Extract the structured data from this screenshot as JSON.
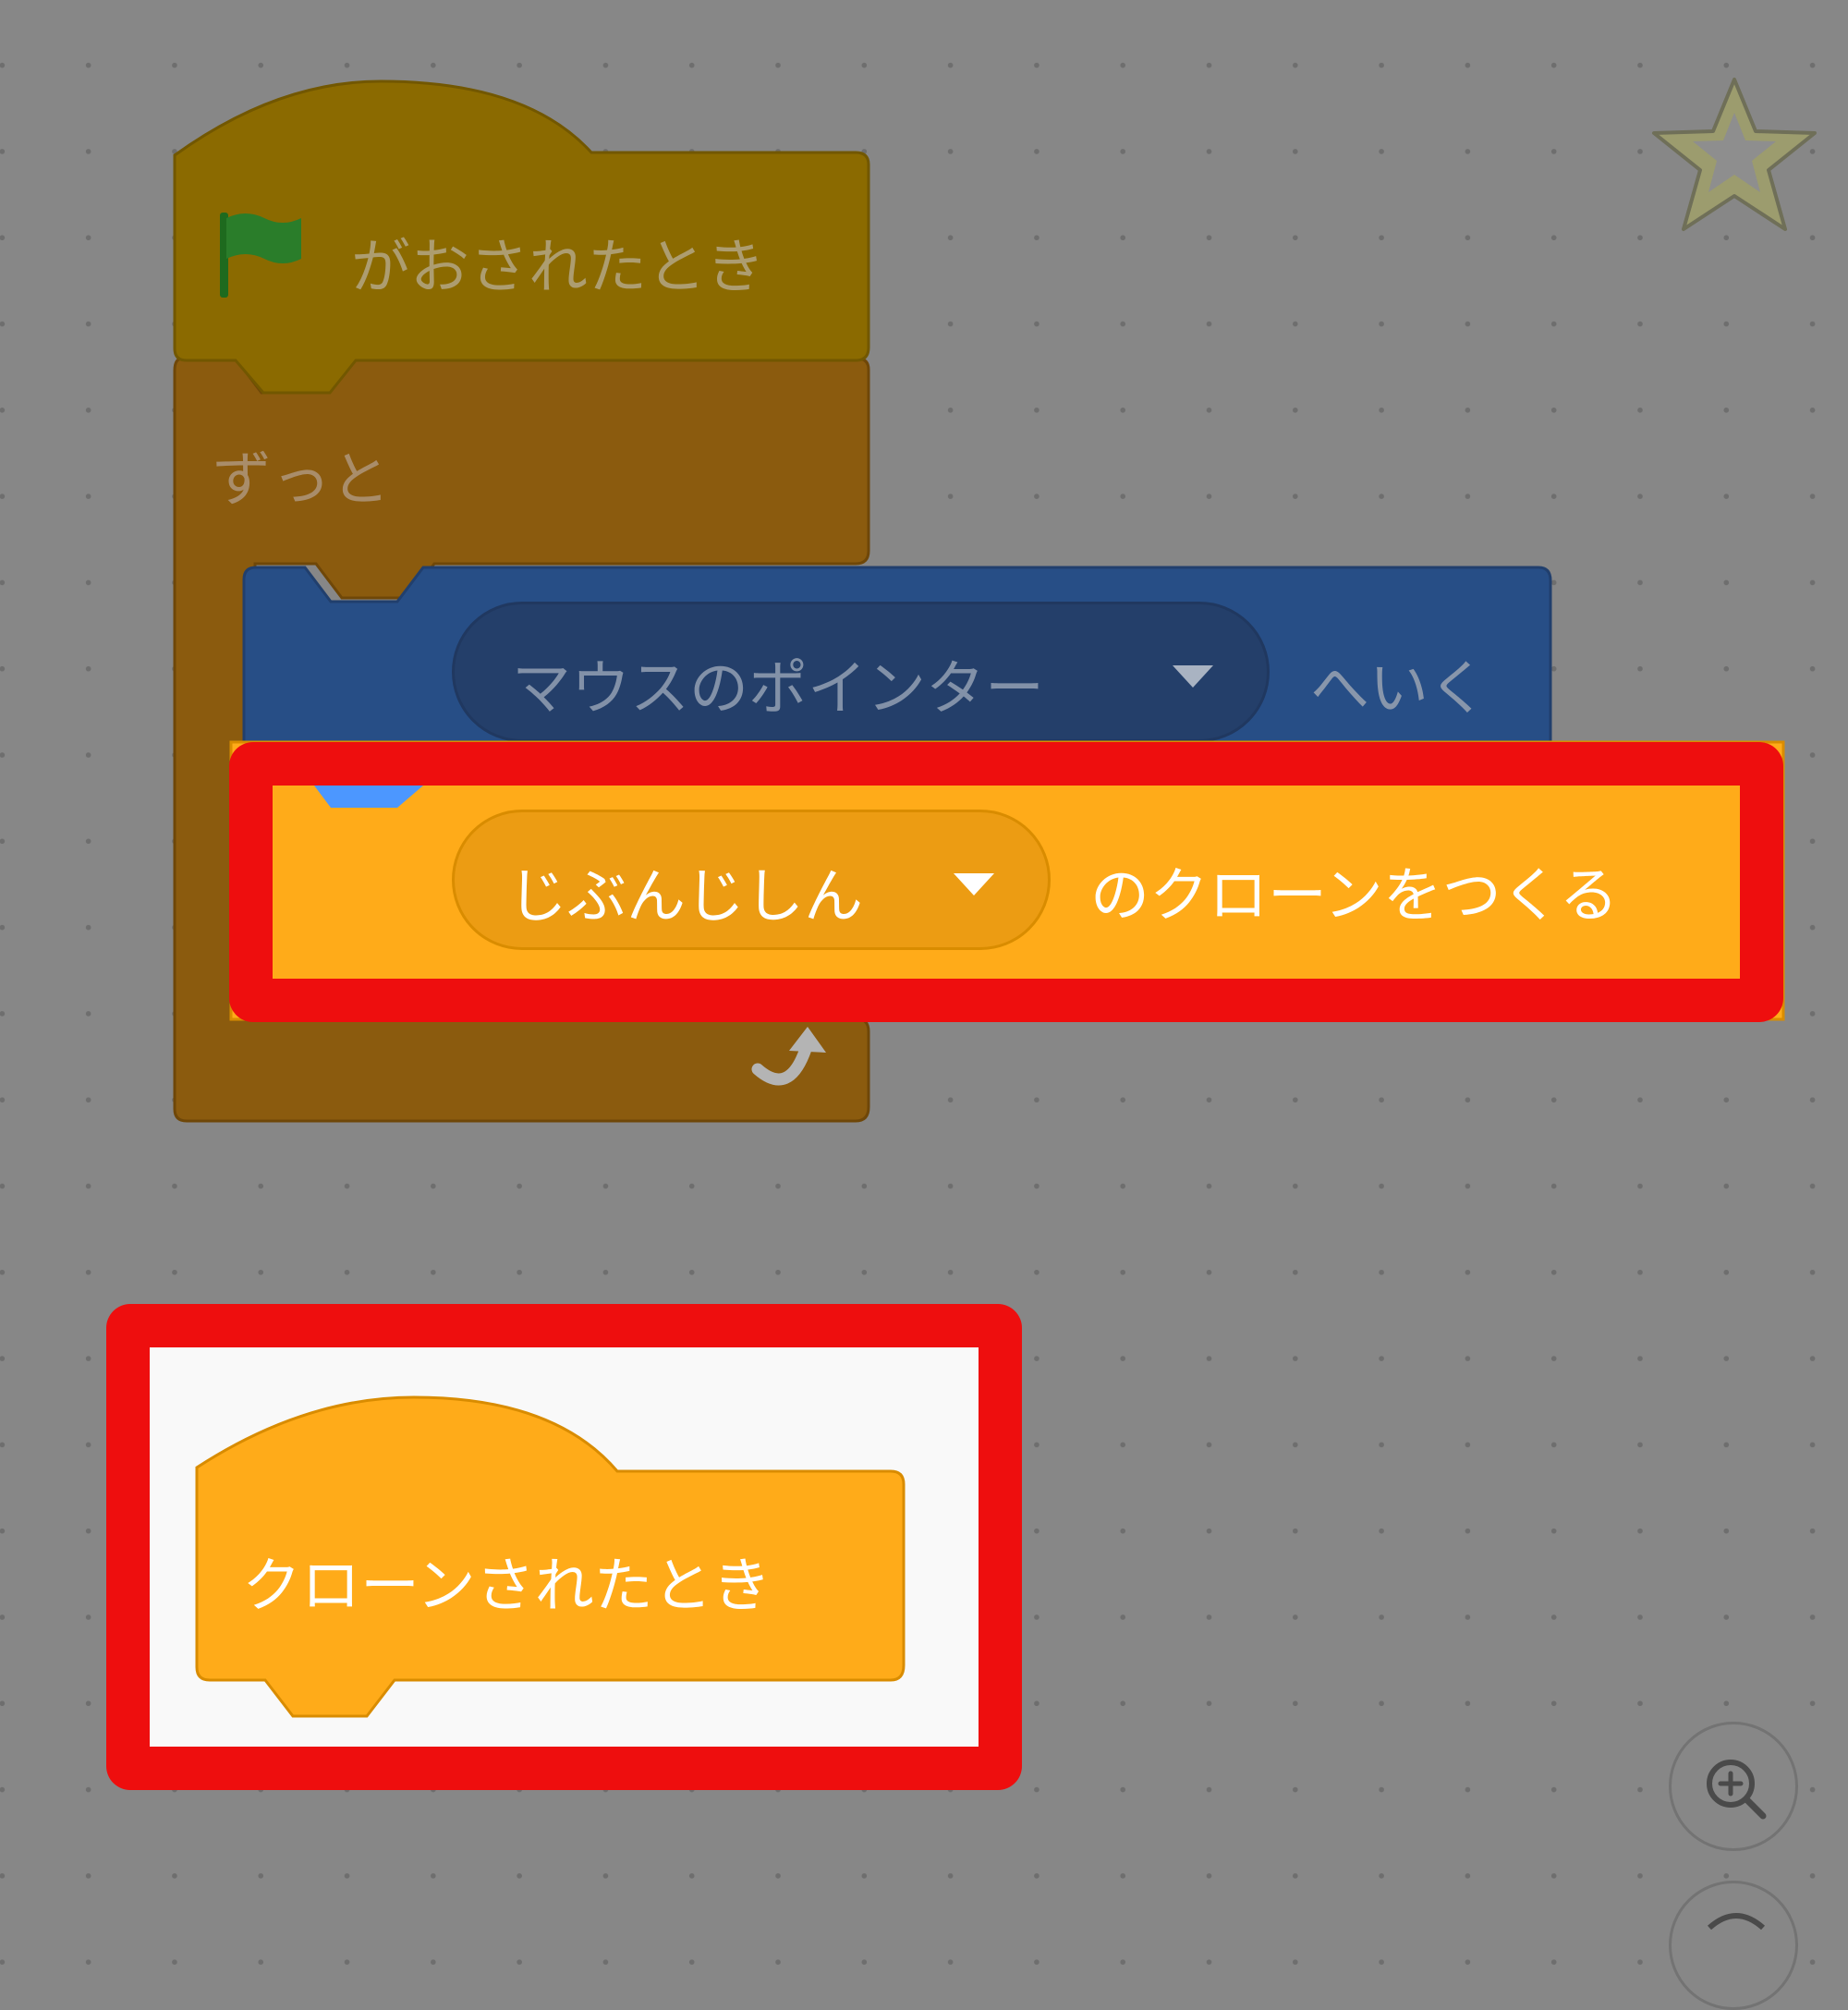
{
  "workspace": {
    "flag_hat_block": {
      "label": "がおされたとき"
    },
    "forever_block": {
      "label": "ずっと"
    },
    "goto_block": {
      "dropdown_value": "マウスのポインター",
      "suffix": "へいく"
    },
    "create_clone_block": {
      "dropdown_value": "じぶんじしん",
      "suffix": "のクローンをつくる"
    }
  },
  "palette": {
    "clone_hat_block": {
      "label": "クローンされたとき"
    }
  },
  "icons": {
    "flag": "green-flag-icon",
    "loop_arrow": "loop-arrow-icon",
    "favorite": "star-icon",
    "zoom_in": "zoom-in-icon",
    "zoom_out": "zoom-out-icon"
  },
  "colors": {
    "control": "#ffab19",
    "control_dimmed": "#8b5b0e",
    "events_dimmed": "#8b6a00",
    "motion_dimmed": "#274e86",
    "highlight": "#ee0e0e",
    "canvas_dimmed": "#878787"
  }
}
